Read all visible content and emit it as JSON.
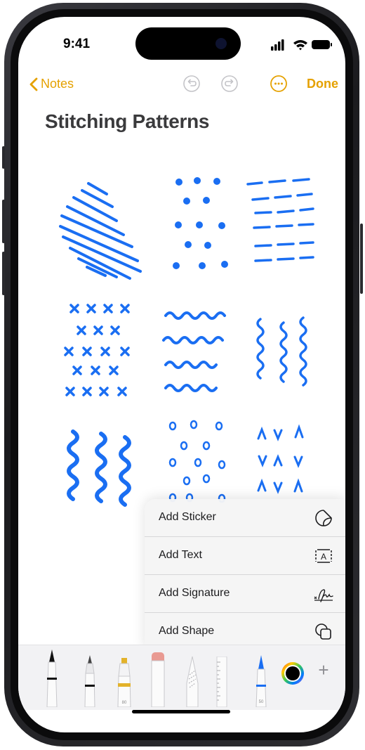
{
  "status_bar": {
    "time": "9:41"
  },
  "navbar": {
    "back_label": "Notes",
    "done_label": "Done"
  },
  "note": {
    "title": "Stitching Patterns"
  },
  "popup_menu": {
    "items": [
      {
        "label": "Add Sticker",
        "icon": "sticker-icon"
      },
      {
        "label": "Add Text",
        "icon": "text-box-icon",
        "icon_glyph": "A"
      },
      {
        "label": "Add Signature",
        "icon": "signature-icon"
      },
      {
        "label": "Add Shape",
        "icon": "shape-icon"
      }
    ]
  },
  "toolbar": {
    "tools": [
      {
        "name": "pen",
        "icon": "pen-icon"
      },
      {
        "name": "monoline",
        "icon": "monoline-pen-icon"
      },
      {
        "name": "highlighter",
        "icon": "highlighter-icon",
        "size_label": "80"
      },
      {
        "name": "eraser",
        "icon": "eraser-icon"
      },
      {
        "name": "lasso",
        "icon": "lasso-icon"
      },
      {
        "name": "ruler",
        "icon": "ruler-icon"
      },
      {
        "name": "selected pen",
        "icon": "blue-pen-icon",
        "size_label": "50"
      },
      {
        "name": "color picker",
        "icon": "color-wheel-icon"
      },
      {
        "name": "add",
        "icon": "plus-icon",
        "glyph": "+"
      }
    ]
  },
  "colors": {
    "accent": "#e5a100",
    "ink": "#1a6ef2",
    "title": "#3a3a3c"
  }
}
